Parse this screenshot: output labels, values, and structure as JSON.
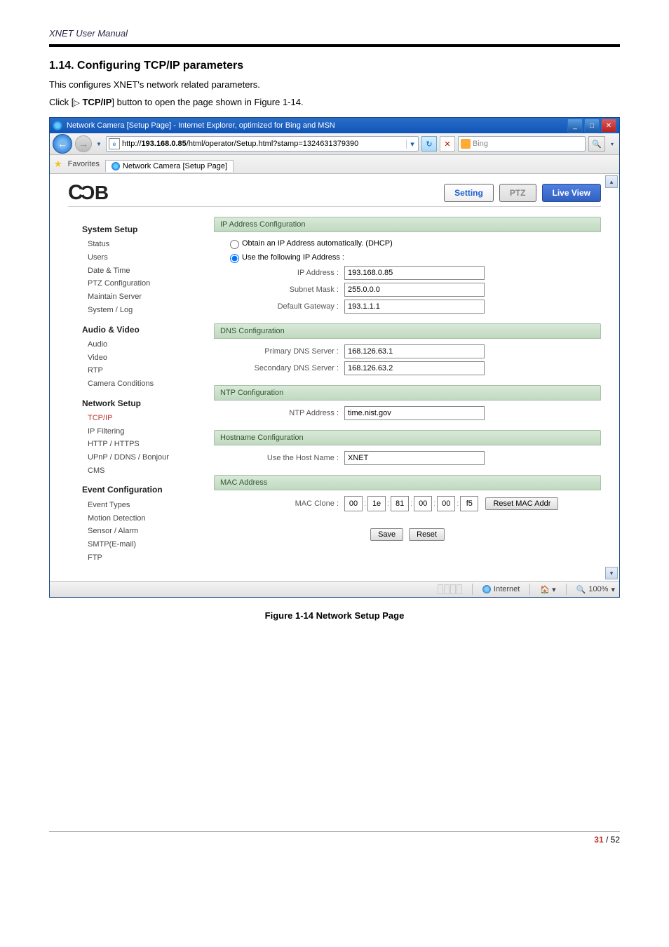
{
  "doc": {
    "header": "XNET User Manual",
    "section_num": "1.14.",
    "section_title": "Configuring TCP/IP parameters",
    "desc": "This configures XNET's network related parameters.",
    "click_prefix": "Click [",
    "click_button": "TCP/IP",
    "click_suffix": "] button to open the page shown in Figure 1-14.",
    "caption": "Figure 1-14 Network Setup Page",
    "page_cur": "31",
    "page_sep": " / ",
    "page_total": "52"
  },
  "browser": {
    "title": "Network Camera [Setup Page] - Internet Explorer, optimized for Bing and MSN",
    "url_prefix": "http://",
    "url_host": "193.168.0.85",
    "url_path": "/html/operator/Setup.html?stamp=1324631379390",
    "search_placeholder": "Bing",
    "favorites_label": "Favorites",
    "tab_label": "Network Camera [Setup Page]",
    "status_zone": "Internet",
    "status_zoom": "100%"
  },
  "app": {
    "logo": "CNB",
    "btn_setting": "Setting",
    "btn_ptz": "PTZ",
    "btn_live": "Live View"
  },
  "sidebar": {
    "g1": "System Setup",
    "g1_items": {
      "a": "Status",
      "b": "Users",
      "c": "Date & Time",
      "d": "PTZ Configuration",
      "e": "Maintain Server",
      "f": "System / Log"
    },
    "g2": "Audio & Video",
    "g2_items": {
      "a": "Audio",
      "b": "Video",
      "c": "RTP",
      "d": "Camera Conditions"
    },
    "g3": "Network Setup",
    "g3_items": {
      "a": "TCP/IP",
      "b": "IP Filtering",
      "c": "HTTP / HTTPS",
      "d": "UPnP / DDNS / Bonjour",
      "e": "CMS"
    },
    "g4": "Event Configuration",
    "g4_items": {
      "a": "Event Types",
      "b": "Motion Detection",
      "c": "Sensor / Alarm",
      "d": "SMTP(E-mail)",
      "e": "FTP"
    }
  },
  "form": {
    "ip_header": "IP Address Configuration",
    "ip_dhcp": "Obtain an IP Address automatically. (DHCP)",
    "ip_static": "Use the following IP Address :",
    "ip_addr_label": "IP Address :",
    "ip_addr_val": "193.168.0.85",
    "subnet_label": "Subnet Mask :",
    "subnet_val": "255.0.0.0",
    "gateway_label": "Default Gateway :",
    "gateway_val": "193.1.1.1",
    "dns_header": "DNS Configuration",
    "dns1_label": "Primary DNS Server :",
    "dns1_val": "168.126.63.1",
    "dns2_label": "Secondary DNS Server :",
    "dns2_val": "168.126.63.2",
    "ntp_header": "NTP Configuration",
    "ntp_label": "NTP Address :",
    "ntp_val": "time.nist.gov",
    "host_header": "Hostname Configuration",
    "host_label": "Use the Host Name :",
    "host_val": "XNET",
    "mac_header": "MAC Address",
    "mac_label": "MAC Clone :",
    "mac": {
      "a": "00",
      "b": "1e",
      "c": "81",
      "d": "00",
      "e": "00",
      "f": "f5"
    },
    "mac_reset": "Reset MAC Addr",
    "save": "Save",
    "reset": "Reset"
  }
}
